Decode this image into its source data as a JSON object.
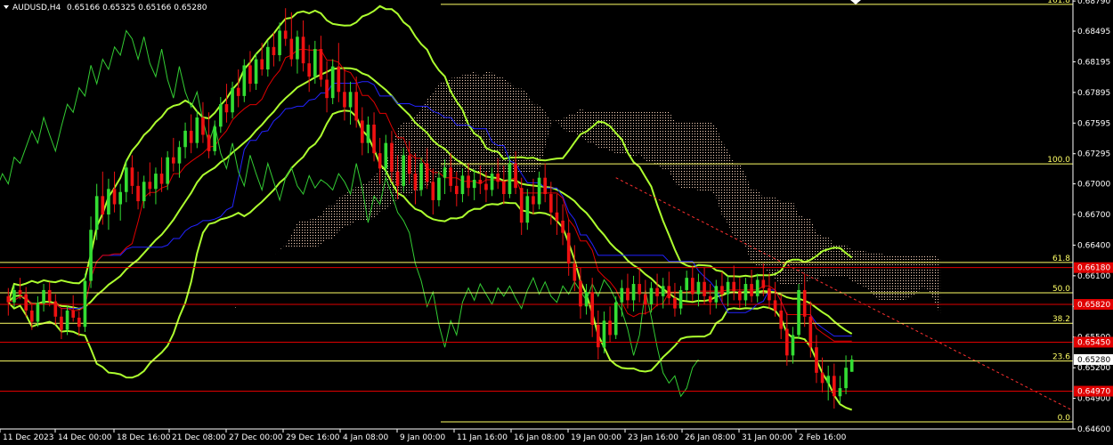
{
  "header": {
    "symbol": "AUDUSD,H4",
    "ohlc_text": "0.65166 0.65325 0.65166 0.65280"
  },
  "chart_data": {
    "type": "candlestick",
    "symbol": "AUDUSD",
    "timeframe": "H4",
    "ylim": [
      0.646,
      0.688
    ],
    "y_ticks": [
      0.6879,
      0.68495,
      0.68195,
      0.67895,
      0.67595,
      0.67295,
      0.67,
      0.667,
      0.664,
      0.661,
      0.658,
      0.655,
      0.652,
      0.649,
      0.646
    ],
    "x_ticks": [
      "11 Dec 2023",
      "14 Dec 00:00",
      "18 Dec 16:00",
      "21 Dec 08:00",
      "27 Dec 00:00",
      "29 Dec 16:00",
      "4 Jan 08:00",
      "9 Jan 00:00",
      "11 Jan 16:00",
      "16 Jan 08:00",
      "19 Jan 00:00",
      "23 Jan 16:00",
      "26 Jan 08:00",
      "31 Jan 00:00",
      "2 Feb 16:00"
    ],
    "fibonacci": {
      "levels": [
        {
          "label": "161.8",
          "price": 0.68757
        },
        {
          "label": "100.0",
          "price": 0.67196
        },
        {
          "label": "61.8",
          "price": 0.66231
        },
        {
          "label": "50.0",
          "price": 0.65933
        },
        {
          "label": "38.2",
          "price": 0.65635
        },
        {
          "label": "23.6",
          "price": 0.65266
        },
        {
          "label": "0.0",
          "price": 0.6467
        }
      ],
      "color": "#ffff66"
    },
    "horizontal_lines": [
      {
        "label": "0.66180",
        "price": 0.6618
      },
      {
        "label": "0.65820",
        "price": 0.6582
      },
      {
        "label": "0.65450",
        "price": 0.6545
      },
      {
        "label": "0.64970",
        "price": 0.6497
      }
    ],
    "current_price": {
      "label": "0.65280",
      "price": 0.6528
    },
    "candles": [
      [
        0.659,
        0.6598,
        0.6571,
        0.6584
      ],
      [
        0.6584,
        0.6601,
        0.6579,
        0.6596
      ],
      [
        0.6596,
        0.6608,
        0.6587,
        0.6592
      ],
      [
        0.6592,
        0.6599,
        0.657,
        0.6576
      ],
      [
        0.6576,
        0.6582,
        0.6557,
        0.6565
      ],
      [
        0.6565,
        0.659,
        0.656,
        0.6583
      ],
      [
        0.6583,
        0.6602,
        0.6575,
        0.6596
      ],
      [
        0.6596,
        0.6604,
        0.658,
        0.6585
      ],
      [
        0.6585,
        0.6592,
        0.6562,
        0.657
      ],
      [
        0.657,
        0.6578,
        0.6548,
        0.6557
      ],
      [
        0.6557,
        0.6581,
        0.6552,
        0.6576
      ],
      [
        0.6576,
        0.6591,
        0.6565,
        0.6569
      ],
      [
        0.6569,
        0.6575,
        0.6551,
        0.656
      ],
      [
        0.656,
        0.6612,
        0.6555,
        0.6605
      ],
      [
        0.6605,
        0.6668,
        0.6598,
        0.6655
      ],
      [
        0.6655,
        0.67,
        0.6645,
        0.6688
      ],
      [
        0.6688,
        0.6712,
        0.666,
        0.667
      ],
      [
        0.667,
        0.6705,
        0.6655,
        0.6695
      ],
      [
        0.6695,
        0.6712,
        0.6672,
        0.668
      ],
      [
        0.668,
        0.67,
        0.6664,
        0.6692
      ],
      [
        0.6692,
        0.6724,
        0.6682,
        0.6716
      ],
      [
        0.6716,
        0.6728,
        0.669,
        0.6698
      ],
      [
        0.6698,
        0.6712,
        0.6675,
        0.6683
      ],
      [
        0.6683,
        0.6708,
        0.6676,
        0.6702
      ],
      [
        0.6702,
        0.6721,
        0.6688,
        0.6695
      ],
      [
        0.6695,
        0.6716,
        0.668,
        0.671
      ],
      [
        0.671,
        0.6726,
        0.6692,
        0.67
      ],
      [
        0.67,
        0.6732,
        0.6694,
        0.6726
      ],
      [
        0.6726,
        0.6745,
        0.6712,
        0.672
      ],
      [
        0.672,
        0.6742,
        0.6706,
        0.6736
      ],
      [
        0.6736,
        0.676,
        0.6725,
        0.6752
      ],
      [
        0.6752,
        0.6768,
        0.673,
        0.674
      ],
      [
        0.674,
        0.6772,
        0.6735,
        0.6765
      ],
      [
        0.6765,
        0.678,
        0.674,
        0.6748
      ],
      [
        0.6748,
        0.677,
        0.6725,
        0.6732
      ],
      [
        0.6732,
        0.6762,
        0.6728,
        0.6756
      ],
      [
        0.6756,
        0.6785,
        0.675,
        0.6778
      ],
      [
        0.6778,
        0.6798,
        0.676,
        0.677
      ],
      [
        0.677,
        0.68,
        0.6764,
        0.6794
      ],
      [
        0.6794,
        0.6812,
        0.6775,
        0.6786
      ],
      [
        0.6786,
        0.6822,
        0.678,
        0.6816
      ],
      [
        0.6816,
        0.683,
        0.679,
        0.6798
      ],
      [
        0.6798,
        0.6828,
        0.6792,
        0.6822
      ],
      [
        0.6822,
        0.6838,
        0.6806,
        0.6812
      ],
      [
        0.6812,
        0.684,
        0.6805,
        0.6834
      ],
      [
        0.6834,
        0.6848,
        0.6815,
        0.6826
      ],
      [
        0.6826,
        0.6858,
        0.682,
        0.685
      ],
      [
        0.685,
        0.6872,
        0.6835,
        0.6842
      ],
      [
        0.6842,
        0.6868,
        0.6815,
        0.6822
      ],
      [
        0.6822,
        0.685,
        0.6808,
        0.6844
      ],
      [
        0.6844,
        0.686,
        0.681,
        0.6818
      ],
      [
        0.6818,
        0.6836,
        0.679,
        0.6805
      ],
      [
        0.6805,
        0.684,
        0.6798,
        0.6832
      ],
      [
        0.6832,
        0.6845,
        0.6795,
        0.6802
      ],
      [
        0.6802,
        0.682,
        0.677,
        0.6784
      ],
      [
        0.6784,
        0.6822,
        0.6778,
        0.6815
      ],
      [
        0.6815,
        0.6838,
        0.678,
        0.679
      ],
      [
        0.679,
        0.6812,
        0.6762,
        0.6775
      ],
      [
        0.6775,
        0.68,
        0.6758,
        0.679
      ],
      [
        0.679,
        0.6805,
        0.6755,
        0.6762
      ],
      [
        0.6762,
        0.6775,
        0.6728,
        0.674
      ],
      [
        0.674,
        0.6766,
        0.673,
        0.6758
      ],
      [
        0.6758,
        0.677,
        0.6722,
        0.673
      ],
      [
        0.673,
        0.6745,
        0.67,
        0.6715
      ],
      [
        0.6715,
        0.6748,
        0.6708,
        0.674
      ],
      [
        0.674,
        0.6752,
        0.6702,
        0.6712
      ],
      [
        0.6712,
        0.6728,
        0.6685,
        0.6698
      ],
      [
        0.6698,
        0.6735,
        0.6692,
        0.6728
      ],
      [
        0.6728,
        0.6742,
        0.67,
        0.671
      ],
      [
        0.671,
        0.673,
        0.668,
        0.6694
      ],
      [
        0.6694,
        0.6726,
        0.6688,
        0.672
      ],
      [
        0.672,
        0.6735,
        0.6695,
        0.6702
      ],
      [
        0.6702,
        0.6715,
        0.667,
        0.6684
      ],
      [
        0.6684,
        0.6712,
        0.6678,
        0.6706
      ],
      [
        0.6706,
        0.6724,
        0.669,
        0.6716
      ],
      [
        0.6716,
        0.673,
        0.6692,
        0.6698
      ],
      [
        0.6698,
        0.6712,
        0.6678,
        0.669
      ],
      [
        0.669,
        0.6715,
        0.6682,
        0.6708
      ],
      [
        0.6708,
        0.672,
        0.6688,
        0.6696
      ],
      [
        0.6696,
        0.6714,
        0.6684,
        0.6704
      ],
      [
        0.6704,
        0.6718,
        0.669,
        0.67
      ],
      [
        0.67,
        0.6712,
        0.6682,
        0.6694
      ],
      [
        0.6694,
        0.6716,
        0.6688,
        0.671
      ],
      [
        0.671,
        0.6725,
        0.6695,
        0.6702
      ],
      [
        0.6702,
        0.6718,
        0.668,
        0.669
      ],
      [
        0.669,
        0.6728,
        0.6686,
        0.672
      ],
      [
        0.672,
        0.6732,
        0.669,
        0.6696
      ],
      [
        0.6696,
        0.6706,
        0.665,
        0.6662
      ],
      [
        0.6662,
        0.6695,
        0.6655,
        0.6688
      ],
      [
        0.6688,
        0.6705,
        0.667,
        0.668
      ],
      [
        0.668,
        0.6712,
        0.6675,
        0.6706
      ],
      [
        0.6706,
        0.672,
        0.6682,
        0.669
      ],
      [
        0.669,
        0.6702,
        0.666,
        0.6672
      ],
      [
        0.6672,
        0.669,
        0.665,
        0.6664
      ],
      [
        0.6664,
        0.668,
        0.664,
        0.6652
      ],
      [
        0.6652,
        0.6665,
        0.661,
        0.6622
      ],
      [
        0.6622,
        0.664,
        0.6595,
        0.6605
      ],
      [
        0.6605,
        0.6618,
        0.6568,
        0.658
      ],
      [
        0.658,
        0.6602,
        0.6572,
        0.6594
      ],
      [
        0.6594,
        0.6608,
        0.655,
        0.6562
      ],
      [
        0.6562,
        0.6576,
        0.6528,
        0.654
      ],
      [
        0.654,
        0.6575,
        0.6534,
        0.6566
      ],
      [
        0.6566,
        0.658,
        0.6545,
        0.6552
      ],
      [
        0.6552,
        0.659,
        0.6548,
        0.6584
      ],
      [
        0.6584,
        0.6606,
        0.657,
        0.6598
      ],
      [
        0.6598,
        0.6612,
        0.6578,
        0.6586
      ],
      [
        0.6586,
        0.661,
        0.6575,
        0.6602
      ],
      [
        0.6602,
        0.6618,
        0.6584,
        0.6592
      ],
      [
        0.6592,
        0.6606,
        0.6572,
        0.6582
      ],
      [
        0.6582,
        0.6604,
        0.6574,
        0.6598
      ],
      [
        0.6598,
        0.6612,
        0.658,
        0.659
      ],
      [
        0.659,
        0.6608,
        0.6578,
        0.66
      ],
      [
        0.66,
        0.6614,
        0.6582,
        0.6588
      ],
      [
        0.6588,
        0.6603,
        0.657,
        0.6578
      ],
      [
        0.6578,
        0.66,
        0.6572,
        0.6596
      ],
      [
        0.6596,
        0.6615,
        0.6586,
        0.6608
      ],
      [
        0.6608,
        0.662,
        0.6585,
        0.6592
      ],
      [
        0.6592,
        0.6612,
        0.658,
        0.6604
      ],
      [
        0.6604,
        0.6618,
        0.6582,
        0.659
      ],
      [
        0.659,
        0.6602,
        0.6572,
        0.6584
      ],
      [
        0.6584,
        0.6606,
        0.6578,
        0.66
      ],
      [
        0.66,
        0.6614,
        0.6584,
        0.6592
      ],
      [
        0.6592,
        0.661,
        0.658,
        0.6604
      ],
      [
        0.6604,
        0.662,
        0.6586,
        0.6595
      ],
      [
        0.6595,
        0.6608,
        0.6578,
        0.6586
      ],
      [
        0.6586,
        0.6608,
        0.658,
        0.6602
      ],
      [
        0.6602,
        0.6616,
        0.6584,
        0.659
      ],
      [
        0.659,
        0.6612,
        0.6584,
        0.6606
      ],
      [
        0.6606,
        0.6622,
        0.659,
        0.6598
      ],
      [
        0.6598,
        0.6612,
        0.6578,
        0.6586
      ],
      [
        0.6586,
        0.6604,
        0.657,
        0.6576
      ],
      [
        0.6576,
        0.6592,
        0.6548,
        0.6558
      ],
      [
        0.6558,
        0.6574,
        0.6522,
        0.6532
      ],
      [
        0.6532,
        0.656,
        0.6524,
        0.6552
      ],
      [
        0.6552,
        0.6602,
        0.6548,
        0.6596
      ],
      [
        0.6596,
        0.6612,
        0.656,
        0.657
      ],
      [
        0.657,
        0.6585,
        0.653,
        0.654
      ],
      [
        0.654,
        0.6552,
        0.6505,
        0.6515
      ],
      [
        0.6515,
        0.653,
        0.6496,
        0.6505
      ],
      [
        0.6505,
        0.6522,
        0.6488,
        0.6512
      ],
      [
        0.6512,
        0.6524,
        0.648,
        0.6492
      ],
      [
        0.6492,
        0.6512,
        0.6485,
        0.65
      ],
      [
        0.65,
        0.6532,
        0.6494,
        0.652
      ],
      [
        0.6516,
        0.6532,
        0.6516,
        0.6528
      ]
    ]
  }
}
